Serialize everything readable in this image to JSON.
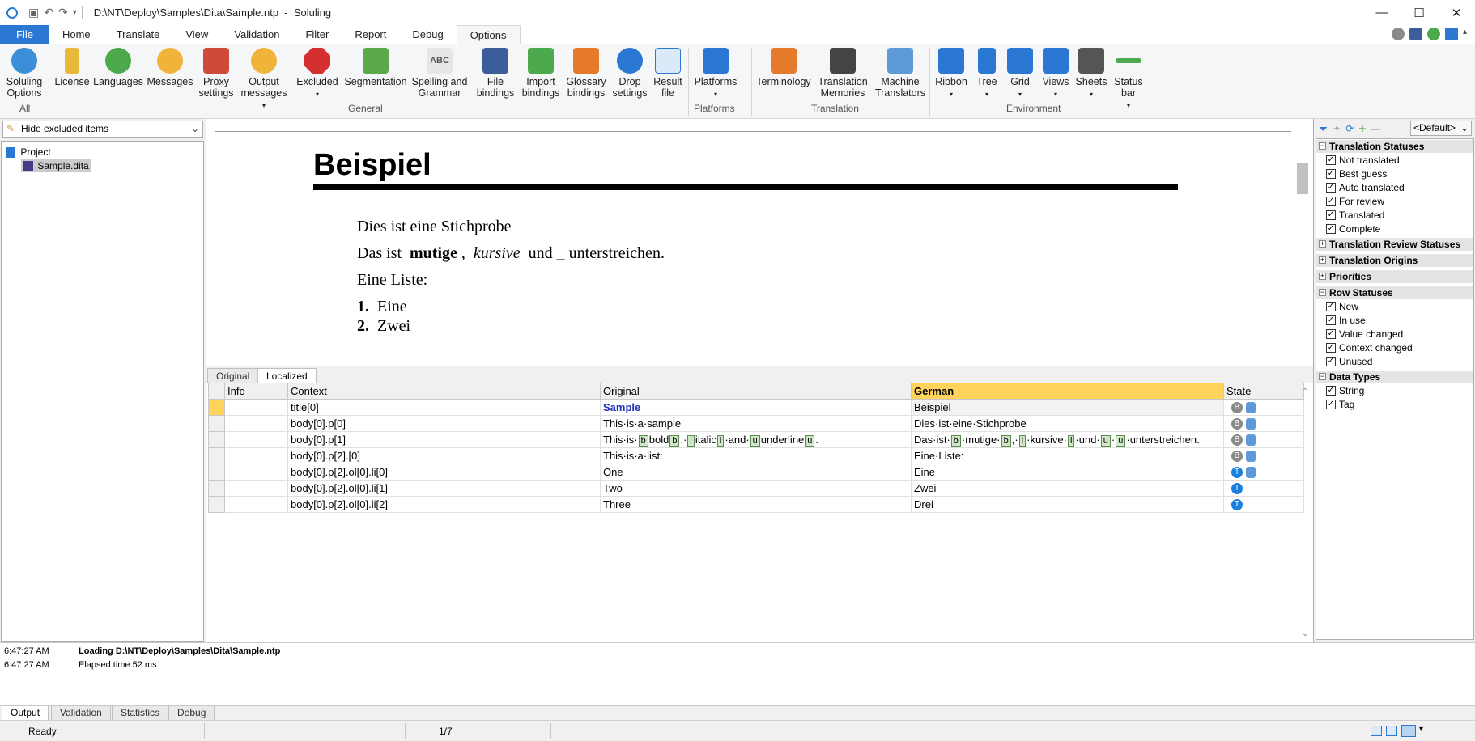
{
  "window": {
    "path": "D:\\NT\\Deploy\\Samples\\Dita\\Sample.ntp",
    "app_name": "Soluling",
    "title_sep": "-"
  },
  "menu_tabs": [
    "File",
    "Home",
    "Translate",
    "View",
    "Validation",
    "Filter",
    "Report",
    "Debug",
    "Options"
  ],
  "ribbon": {
    "buttons": [
      {
        "label": "Soluling Options",
        "icon": "globe-icon",
        "color": "#3a8fd8"
      },
      {
        "label": "License",
        "icon": "key-icon",
        "color": "#e7b93a"
      },
      {
        "label": "Languages",
        "icon": "globe-icon",
        "color": "#4caa4c"
      },
      {
        "label": "Messages",
        "icon": "speech-bubbles-icon",
        "color": "#f0b43a"
      },
      {
        "label": "Proxy settings",
        "icon": "firewall-icon",
        "color": "#d04a3a"
      },
      {
        "label": "Output messages",
        "icon": "speech-bubbles-icon",
        "color": "#f0b43a"
      },
      {
        "label": "Excluded",
        "icon": "stop-sign-icon",
        "color": "#d43030"
      },
      {
        "label": "Segmentation",
        "icon": "segmentation-icon",
        "color": "#5aa84a"
      },
      {
        "label": "Spelling and Grammar",
        "icon": "spell-check-icon",
        "color": "#555555"
      },
      {
        "label": "File bindings",
        "icon": "file-bindings-icon",
        "color": "#3b5e9a"
      },
      {
        "label": "Import bindings",
        "icon": "import-icon",
        "color": "#4caa4c"
      },
      {
        "label": "Glossary bindings",
        "icon": "glossary-icon",
        "color": "#e57a2a"
      },
      {
        "label": "Drop settings",
        "icon": "drop-icon",
        "color": "#2b78d4"
      },
      {
        "label": "Result file",
        "icon": "result-file-icon",
        "color": "#2b78d4"
      },
      {
        "label": "Platforms",
        "icon": "monitor-icon",
        "color": "#2b78d4"
      },
      {
        "label": "Terminology",
        "icon": "terminology-icon",
        "color": "#e57a2a"
      },
      {
        "label": "Translation Memories",
        "icon": "memory-card-icon",
        "color": "#444444"
      },
      {
        "label": "Machine Translators",
        "icon": "robot-icon",
        "color": "#5e9ad8"
      },
      {
        "label": "Ribbon",
        "icon": "ribbon-icon",
        "color": "#2b78d4"
      },
      {
        "label": "Tree",
        "icon": "tree-icon",
        "color": "#2b78d4"
      },
      {
        "label": "Grid",
        "icon": "grid-icon",
        "color": "#2b78d4"
      },
      {
        "label": "Views",
        "icon": "views-icon",
        "color": "#2b78d4"
      },
      {
        "label": "Sheets",
        "icon": "sheets-icon",
        "color": "#555555"
      },
      {
        "label": "Status bar",
        "icon": "status-bar-icon",
        "color": "#4caa4c"
      }
    ],
    "groups": [
      "All",
      "General",
      "Platforms",
      "Translation",
      "Environment"
    ]
  },
  "left_panel": {
    "dropdown": "Hide excluded items",
    "tree": {
      "root": "Project",
      "child": "Sample.dita"
    }
  },
  "preview": {
    "title": "Beispiel",
    "p1": "Dies ist eine Stichprobe",
    "p2": {
      "pre": "Das ist",
      "bold": "mutige",
      "comma": ",",
      "italic": "kursive",
      "und": "und",
      "under": "_",
      "post": "unterstreichen."
    },
    "p3": "Eine Liste:",
    "li": [
      {
        "n": "1.",
        "t": "Eine"
      },
      {
        "n": "2.",
        "t": "Zwei"
      }
    ],
    "tabs": [
      "Original",
      "Localized"
    ]
  },
  "grid": {
    "columns": [
      "Info",
      "Context",
      "Original",
      "German",
      "State"
    ],
    "rows": [
      {
        "context": "title[0]",
        "original": "Sample",
        "german": "Beispiel",
        "state": "B",
        "robot": true
      },
      {
        "context": "body[0].p[0]",
        "original": "This·is·a·sample",
        "german": "Dies·ist·eine·Stichprobe",
        "state": "B",
        "robot": true
      },
      {
        "context": "body[0].p[1]",
        "original": {
          "a": "This·is·",
          "t1": "b",
          "b": "bold",
          "t2": "b",
          "c": ",·",
          "t3": "i",
          "d": "italic",
          "t4": "i",
          "e": "·and·",
          "t5": "u",
          "f": "underline",
          "t6": "u",
          "g": "."
        },
        "german": {
          "a": "Das·ist·",
          "t1": "b",
          "b": "·mutige·",
          "t2": "b",
          "c": ",·",
          "t3": "i",
          "d": "·kursive·",
          "t4": "i",
          "e": "·und·",
          "t5": "u",
          "f": "·",
          "t6": "u",
          "g": "·unterstreichen."
        },
        "state": "B",
        "robot": true
      },
      {
        "context": "body[0].p[2].[0]",
        "original": "This·is·a·list:",
        "german": "Eine·Liste:",
        "state": "B",
        "robot": true
      },
      {
        "context": "body[0].p[2].ol[0].li[0]",
        "original": "One",
        "german": "Eine",
        "state": "T",
        "robot": true
      },
      {
        "context": "body[0].p[2].ol[0].li[1]",
        "original": "Two",
        "german": "Zwei",
        "state": "T",
        "robot": false
      },
      {
        "context": "body[0].p[2].ol[0].li[2]",
        "original": "Three",
        "german": "Drei",
        "state": "T",
        "robot": false
      }
    ]
  },
  "filter_panel": {
    "preset": "<Default>",
    "sections": [
      {
        "title": "Translation Statuses",
        "expanded": true,
        "items": [
          "Not translated",
          "Best guess",
          "Auto translated",
          "For review",
          "Translated",
          "Complete"
        ]
      },
      {
        "title": "Translation Review Statuses",
        "expanded": false,
        "items": []
      },
      {
        "title": "Translation Origins",
        "expanded": false,
        "items": []
      },
      {
        "title": "Priorities",
        "expanded": false,
        "items": []
      },
      {
        "title": "Row Statuses",
        "expanded": true,
        "items": [
          "New",
          "In use",
          "Value changed",
          "Context changed",
          "Unused"
        ]
      },
      {
        "title": "Data Types",
        "expanded": true,
        "items": [
          "String",
          "Tag"
        ]
      }
    ]
  },
  "output": {
    "lines": [
      {
        "time": "6:47:27 AM",
        "text": "Loading D:\\NT\\Deploy\\Samples\\Dita\\Sample.ntp",
        "bold": true
      },
      {
        "time": "6:47:27 AM",
        "text": "Elapsed time 52 ms",
        "bold": false
      }
    ],
    "tabs": [
      "Output",
      "Validation",
      "Statistics",
      "Debug"
    ]
  },
  "status": {
    "left": "Ready",
    "position": "1/7"
  },
  "colors": {
    "accent": "#2b78d4",
    "highlight": "#ffd35c",
    "tag_bg": "#cfe7c8"
  }
}
